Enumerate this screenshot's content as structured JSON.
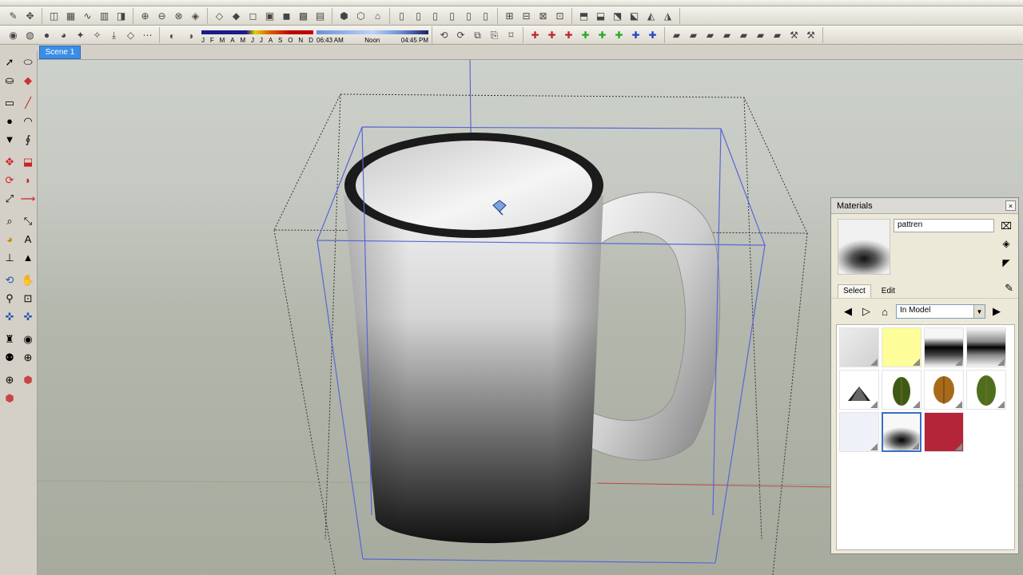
{
  "scene": {
    "tab_label": "Scene 1"
  },
  "toolbar": {
    "months": [
      "J",
      "F",
      "M",
      "A",
      "M",
      "J",
      "J",
      "A",
      "S",
      "O",
      "N",
      "D"
    ],
    "time_labels": [
      "06:43 AM",
      "Noon",
      "04:45 PM"
    ]
  },
  "materials": {
    "title": "Materials",
    "close_glyph": "×",
    "name_value": "pattren",
    "tab_select": "Select",
    "tab_edit": "Edit",
    "collection_value": "In Model",
    "swatches": [
      {
        "name": "grey-material"
      },
      {
        "name": "yellow-material"
      },
      {
        "name": "black-band-material"
      },
      {
        "name": "black-gradient-material"
      },
      {
        "name": "cone-material"
      },
      {
        "name": "green-leaf-material"
      },
      {
        "name": "brown-leaf-material"
      },
      {
        "name": "green-leaf-material-2"
      },
      {
        "name": "light-blue-material"
      },
      {
        "name": "pattren-material",
        "selected": true
      },
      {
        "name": "red-material"
      }
    ]
  },
  "colors": {
    "scene_tab": "#3a8ee6",
    "selection_box": "#5a66d8",
    "swatch_red": "#b5253a",
    "swatch_yellow": "#fdfd99"
  }
}
